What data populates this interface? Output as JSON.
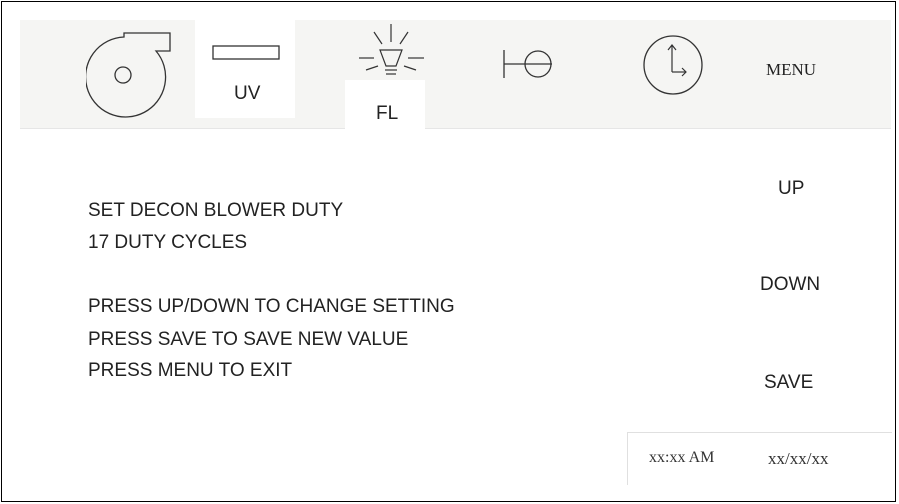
{
  "toolbar": {
    "uv_label": "UV",
    "fl_label": "FL",
    "menu_label": "MENU",
    "icons": [
      "blower-icon",
      "uv-lamp-icon",
      "fluorescent-light-icon",
      "valve-icon",
      "clock-icon"
    ]
  },
  "message": {
    "title": "SET DECON BLOWER DUTY",
    "value": "17 DUTY CYCLES",
    "instructions": [
      "PRESS UP/DOWN TO CHANGE SETTING",
      "PRESS SAVE TO SAVE NEW VALUE",
      "PRESS MENU TO EXIT"
    ]
  },
  "buttons": {
    "up": "UP",
    "down": "DOWN",
    "save": "SAVE"
  },
  "status": {
    "time": "xx:xx AM",
    "date": "xx/xx/xx"
  }
}
